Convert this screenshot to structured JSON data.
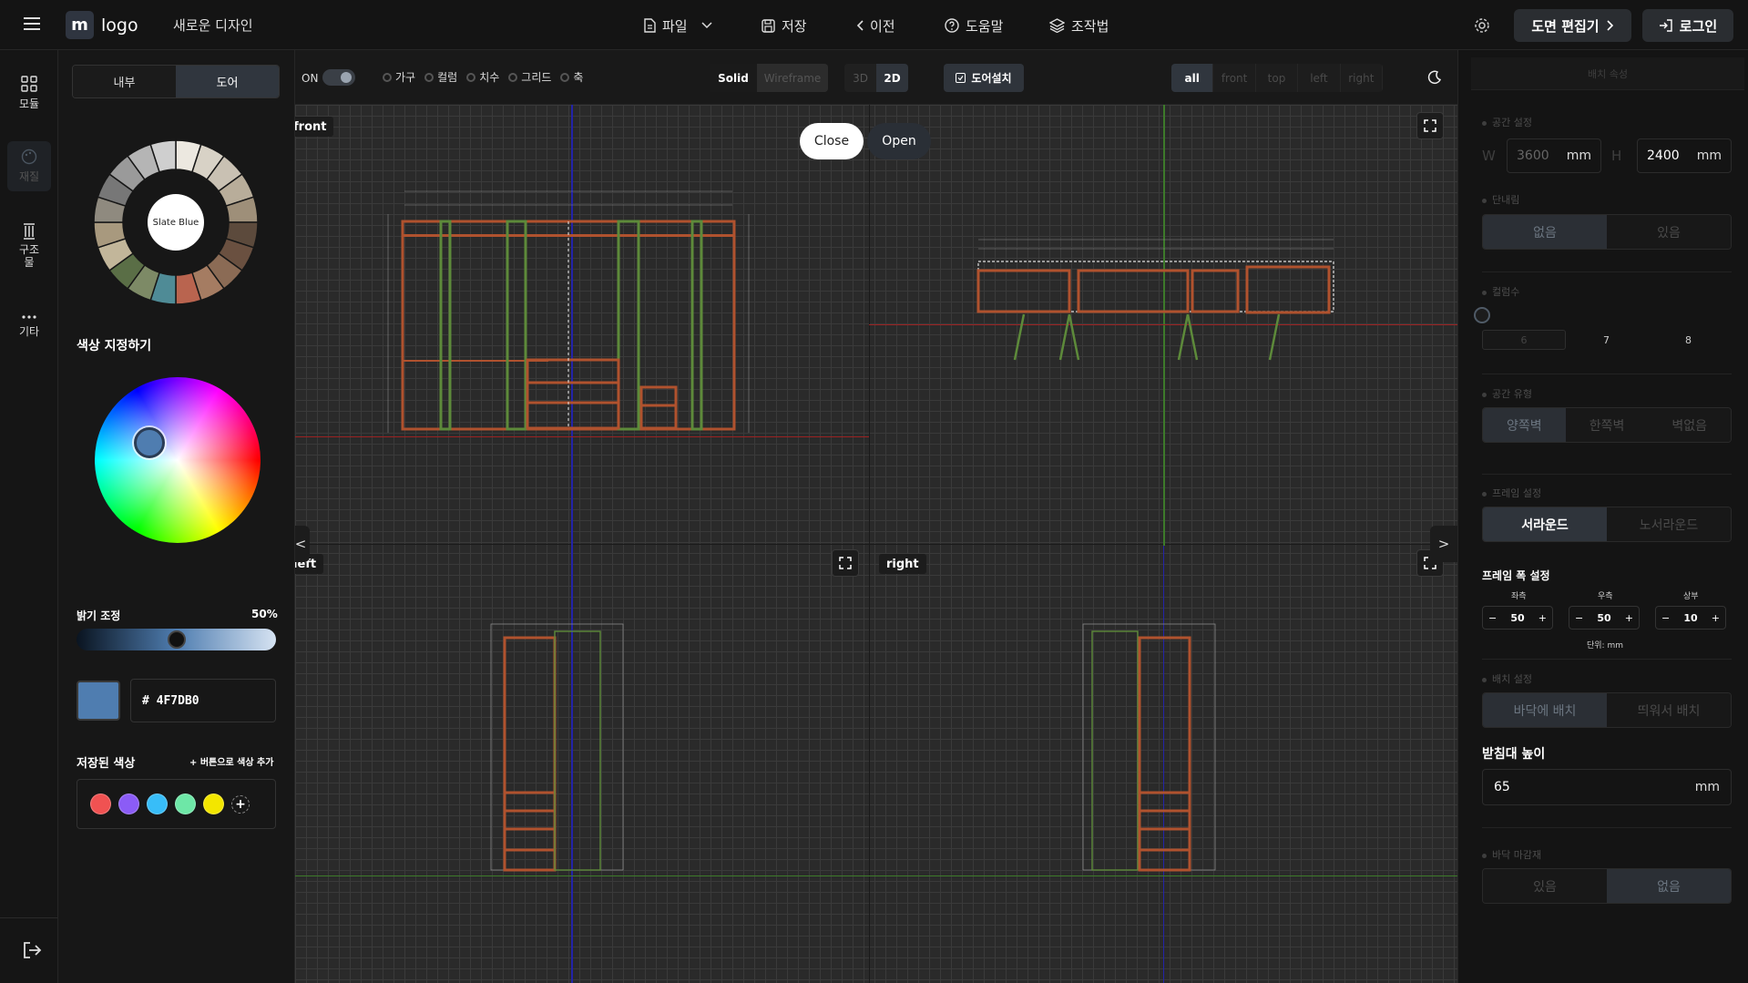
{
  "header": {
    "logo_mark": "m",
    "logo_text": "logo",
    "design_name": "새로운 디자인",
    "menu": {
      "file": "파일",
      "save": "저장",
      "prev": "이전",
      "help": "도움말",
      "controls": "조작법"
    },
    "editor_button": "도면 편집기",
    "login_button": "로그인"
  },
  "rail": [
    {
      "label": "모듈",
      "icon": "grid-icon"
    },
    {
      "label": "재질",
      "icon": "palette-icon"
    },
    {
      "label": "구조물",
      "icon": "column-icon"
    },
    {
      "label": "기타",
      "icon": "more-icon"
    }
  ],
  "color_panel": {
    "tabs": {
      "inner": "내부",
      "door": "도어"
    },
    "wheel_center_label": "Slate Blue",
    "palette_swatches": [
      "#ece8e0",
      "#d8d2c6",
      "#c9c1b3",
      "#b8ad9a",
      "#9e8f79",
      "#5c4a3c",
      "#6a5040",
      "#8b6b55",
      "#a57c62",
      "#b9644f",
      "#4f8b96",
      "#7d8a66",
      "#5a6e46",
      "#c2b69a",
      "#a8997e",
      "#8f8a7f",
      "#777",
      "#9a9a9a",
      "#b5b5b5",
      "#cfcfcf"
    ],
    "pick_title": "색상 지정하기",
    "brightness_label": "밝기 조정",
    "brightness_value": "50%",
    "brightness": 0.5,
    "hex_value": "# 4F7DB0",
    "current_color": "#4F7DB0",
    "saved_title": "저장된 색상",
    "saved_hint": "+ 버튼으로 색상 추가",
    "saved_colors": [
      "#f05252",
      "#8b5cf6",
      "#38bdf8",
      "#6ee7a7",
      "#f3e600"
    ]
  },
  "viewport": {
    "toggle_label": "ON",
    "toggle_on": true,
    "options": [
      "가구",
      "컬럼",
      "치수",
      "그리드",
      "축"
    ],
    "render_modes": [
      "Solid",
      "Wireframe"
    ],
    "dims": [
      "3D",
      "2D"
    ],
    "door_install": "도어설치",
    "views": [
      "all",
      "front",
      "top",
      "left",
      "right"
    ],
    "labels": {
      "front": "front",
      "left": "left",
      "right": "right"
    },
    "popup": {
      "close": "Close",
      "open": "Open"
    },
    "nav_left": "<",
    "nav_right": ">"
  },
  "right_panel": {
    "header": "배치 속성",
    "space": {
      "title": "공간 설정",
      "w_label": "W",
      "w_value": "3600",
      "h_label": "H",
      "h_value": "2400",
      "unit": "mm"
    },
    "step": {
      "title": "단내림",
      "options": [
        "없음",
        "있음"
      ]
    },
    "columns": {
      "title": "컬럼수",
      "values": [
        "6",
        "7",
        "8"
      ]
    },
    "space_type": {
      "title": "공간 유형",
      "options": [
        "양쪽벽",
        "한쪽벽",
        "벽없음"
      ]
    },
    "frame": {
      "title": "프레임 설정",
      "options": [
        "서라운드",
        "노서라운드"
      ]
    },
    "frame_width": {
      "title": "프레임 폭 설정",
      "left_label": "좌측",
      "left": "50",
      "right_label": "우측",
      "right": "50",
      "top_label": "상부",
      "top": "10",
      "unit_note": "단위: mm"
    },
    "placement": {
      "title": "배치 설정",
      "options": [
        "바닥에 배치",
        "띄워서 배치"
      ]
    },
    "base_height": {
      "title": "받침대 높이",
      "value": "65",
      "unit": "mm"
    },
    "floor_finish": {
      "title": "바닥 마감재",
      "options": [
        "있음",
        "없음"
      ]
    }
  }
}
